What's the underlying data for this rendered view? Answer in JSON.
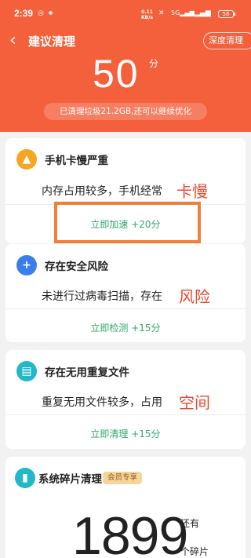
{
  "status_bar": {
    "time": "2:39",
    "net_speed": "0.11\nKB/s",
    "battery": "58"
  },
  "nav": {
    "title": "建议清理",
    "deep_clean": "深度清理"
  },
  "score": {
    "value": "50",
    "unit": "分",
    "summary": "已清理垃圾21.2GB,还可以继续优化"
  },
  "cards": [
    {
      "title": "手机卡慢严重",
      "desc": "内存占用较多，手机经常",
      "keyword": "卡慢",
      "action": "立即加速 +20分",
      "icon": "rocket-icon",
      "icon_color": "#f5a623"
    },
    {
      "title": "存在安全风险",
      "desc": "未进行过病毒扫描，存在",
      "keyword": "风险",
      "action": "立即检测 +15分",
      "icon": "shield-icon",
      "icon_color": "#3b7de9"
    },
    {
      "title": "存在无用重复文件",
      "desc": "重复无用文件较多，占用",
      "keyword": "空间",
      "action": "立即清理 +15分",
      "icon": "files-icon",
      "icon_color": "#22b8c8"
    },
    {
      "title": "系统碎片清理",
      "badge": "会员专享",
      "count": "1899",
      "count_pre": "还有",
      "count_post": "个碎片",
      "icon": "fragment-icon",
      "icon_color": "#22b8c8"
    }
  ],
  "colors": {
    "header": "#f4603c",
    "keyword": "#e94a2f",
    "action": "#2fa867",
    "highlight_box": "#f07f3c"
  }
}
